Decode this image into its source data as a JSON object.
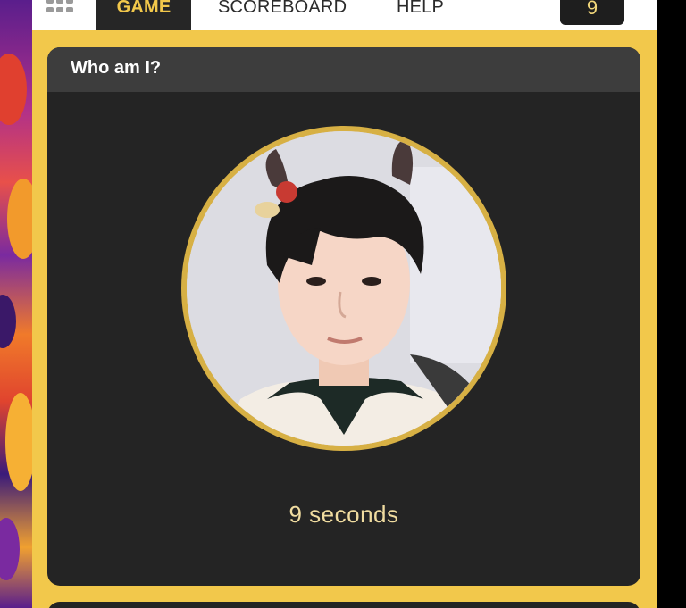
{
  "nav": {
    "menu_icon": "grid-icon",
    "tabs": [
      {
        "label": "GAME",
        "active": true
      },
      {
        "label": "SCOREBOARD",
        "active": false
      },
      {
        "label": "HELP",
        "active": false
      }
    ],
    "score": "9"
  },
  "card": {
    "title": "Who am I?",
    "timer": "9 seconds"
  },
  "colors": {
    "accent": "#f2c84b",
    "card_bg": "#242424",
    "header_bg": "#3d3d3d",
    "ring": "#d7b044"
  }
}
